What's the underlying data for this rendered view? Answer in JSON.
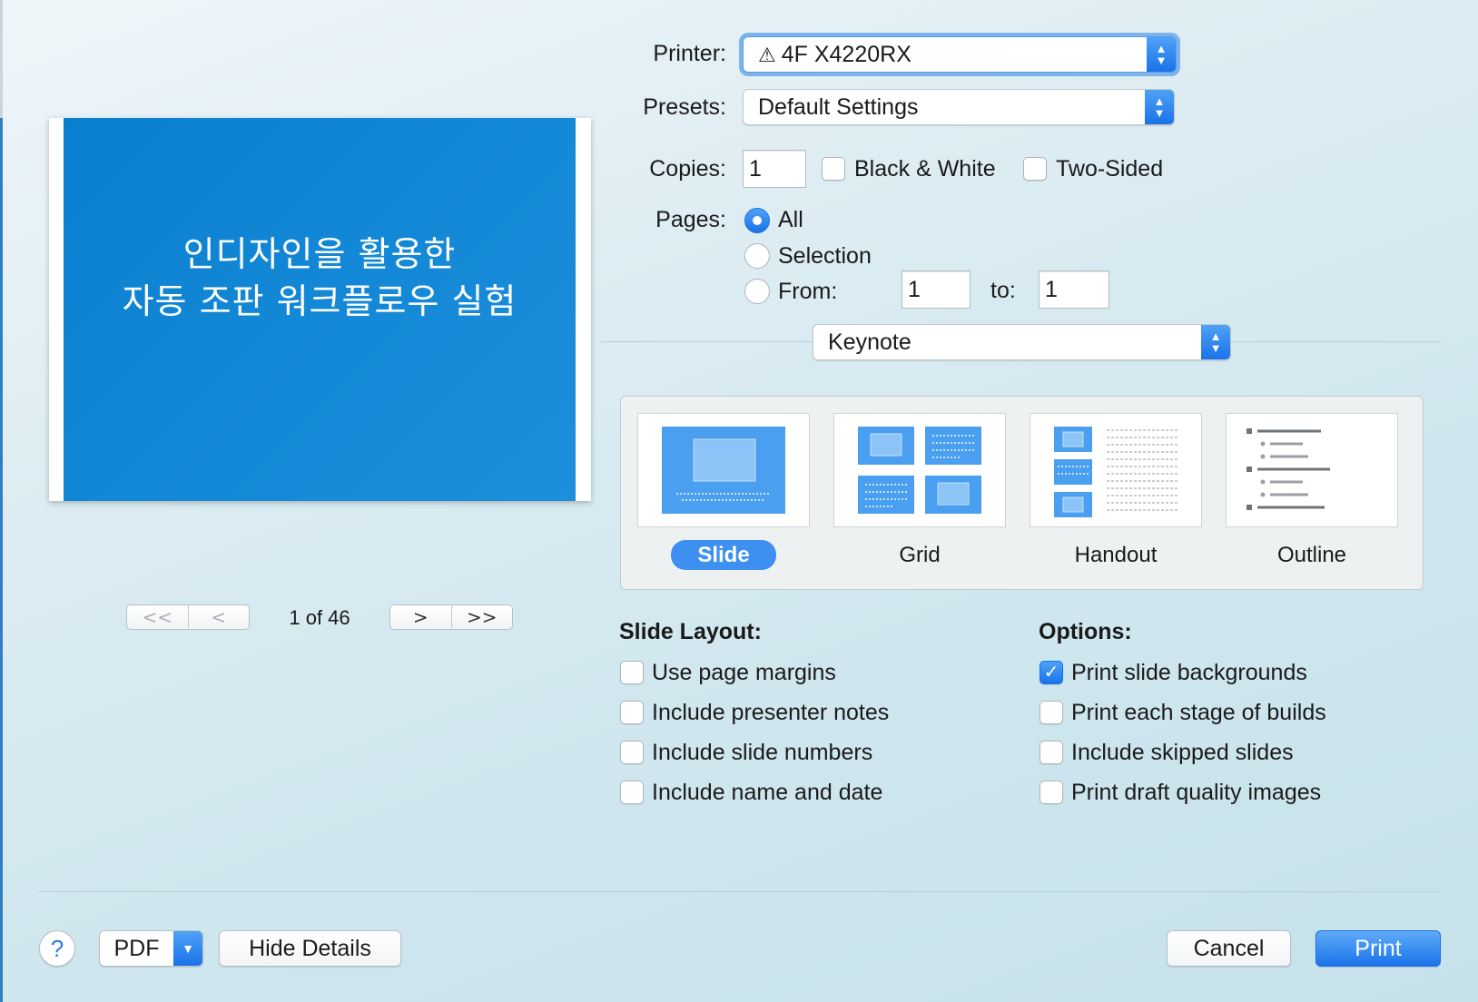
{
  "preview": {
    "slide_title_line1": "인디자인을 활용한",
    "slide_title_line2": "자동 조판 워크플로우 실험",
    "nav_first": "<<",
    "nav_prev": "<",
    "nav_next": ">",
    "nav_last": ">>",
    "page_count": "1 of 46"
  },
  "printer": {
    "label": "Printer:",
    "value": "4F X4220RX",
    "status_icon": "warning-icon"
  },
  "presets": {
    "label": "Presets:",
    "value": "Default Settings"
  },
  "copies": {
    "label": "Copies:",
    "value": "1",
    "black_white": "Black & White",
    "two_sided": "Two-Sided"
  },
  "pages": {
    "label": "Pages:",
    "all": "All",
    "selection": "Selection",
    "from": "From:",
    "from_value": "1",
    "to": "to:",
    "to_value": "1"
  },
  "app_menu": {
    "value": "Keynote"
  },
  "layouts": [
    {
      "label": "Slide",
      "selected": true
    },
    {
      "label": "Grid",
      "selected": false
    },
    {
      "label": "Handout",
      "selected": false
    },
    {
      "label": "Outline",
      "selected": false
    }
  ],
  "slide_layout": {
    "title": "Slide Layout:",
    "items": [
      {
        "label": "Use page margins",
        "checked": false
      },
      {
        "label": "Include presenter notes",
        "checked": false
      },
      {
        "label": "Include slide numbers",
        "checked": false
      },
      {
        "label": "Include name and date",
        "checked": false
      }
    ]
  },
  "options": {
    "title": "Options:",
    "items": [
      {
        "label": "Print slide backgrounds",
        "checked": true
      },
      {
        "label": "Print each stage of builds",
        "checked": false
      },
      {
        "label": "Include skipped slides",
        "checked": false
      },
      {
        "label": "Print draft quality images",
        "checked": false
      }
    ]
  },
  "footer": {
    "help": "?",
    "pdf": "PDF",
    "hide_details": "Hide Details",
    "cancel": "Cancel",
    "print": "Print"
  },
  "colors": {
    "accent": "#1a72e8",
    "slide_blue": "#1388d6"
  }
}
